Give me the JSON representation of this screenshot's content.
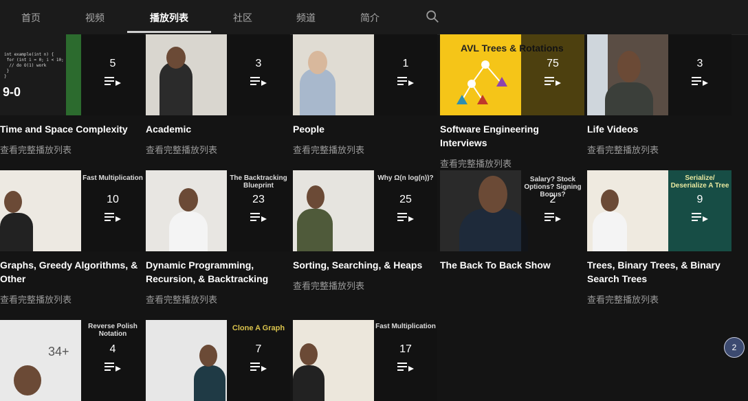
{
  "tabs": [
    "首页",
    "视频",
    "播放列表",
    "社区",
    "频道",
    "简介"
  ],
  "active_tab": "播放列表",
  "view_full_label": "查看完整播放列表",
  "playlists": [
    {
      "title": "Time and Space Complexity",
      "count": "5",
      "thumb_text": "9-0",
      "bg": "#1b1b1b",
      "overlay_text": ""
    },
    {
      "title": "Academic",
      "count": "3",
      "thumb_text": "",
      "bg": "#d9d6cf",
      "overlay_text": ""
    },
    {
      "title": "People",
      "count": "1",
      "thumb_text": "",
      "bg": "#e0dcd3",
      "overlay_text": ""
    },
    {
      "title": "Software Engineering Interviews",
      "count": "75",
      "thumb_text": "AVL Trees & Rotations",
      "bg": "#f5c518",
      "overlay_text": ""
    },
    {
      "title": "Life Videos",
      "count": "3",
      "thumb_text": "",
      "bg": "#5a4d44",
      "overlay_text": ""
    },
    {
      "title": "Graphs, Greedy Algorithms, & Other",
      "count": "10",
      "thumb_text": "",
      "bg": "#ede9e2",
      "overlay_text": "Fast Multiplication"
    },
    {
      "title": "Dynamic Programming, Recursion, & Backtracking",
      "count": "23",
      "thumb_text": "",
      "bg": "#e8e6e2",
      "overlay_text": "The Backtracking Blueprint"
    },
    {
      "title": "Sorting, Searching, & Heaps",
      "count": "25",
      "thumb_text": "",
      "bg": "#e6e4df",
      "overlay_text": "Why Ω(n log(n))?"
    },
    {
      "title": "The Back To Back Show",
      "count": "2",
      "thumb_text": "",
      "bg": "#2a2a2a",
      "overlay_text": "Salary? Stock Options? Signing Bonus?"
    },
    {
      "title": "Trees, Binary Trees, & Binary Search Trees",
      "count": "9",
      "thumb_text": "",
      "bg": "#efeae0",
      "overlay_text": "Serialize/ Deserialize A Tree"
    },
    {
      "title": "",
      "count": "4",
      "thumb_text": "34+",
      "bg": "#e9e9e9",
      "overlay_text": "Reverse Polish Notation"
    },
    {
      "title": "",
      "count": "7",
      "thumb_text": "",
      "bg": "#e7e7e7",
      "overlay_text": "Clone A Graph"
    },
    {
      "title": "",
      "count": "17",
      "thumb_text": "",
      "bg": "#ece7dc",
      "overlay_text": "Fast Multiplication"
    }
  ],
  "page_badge": "2"
}
